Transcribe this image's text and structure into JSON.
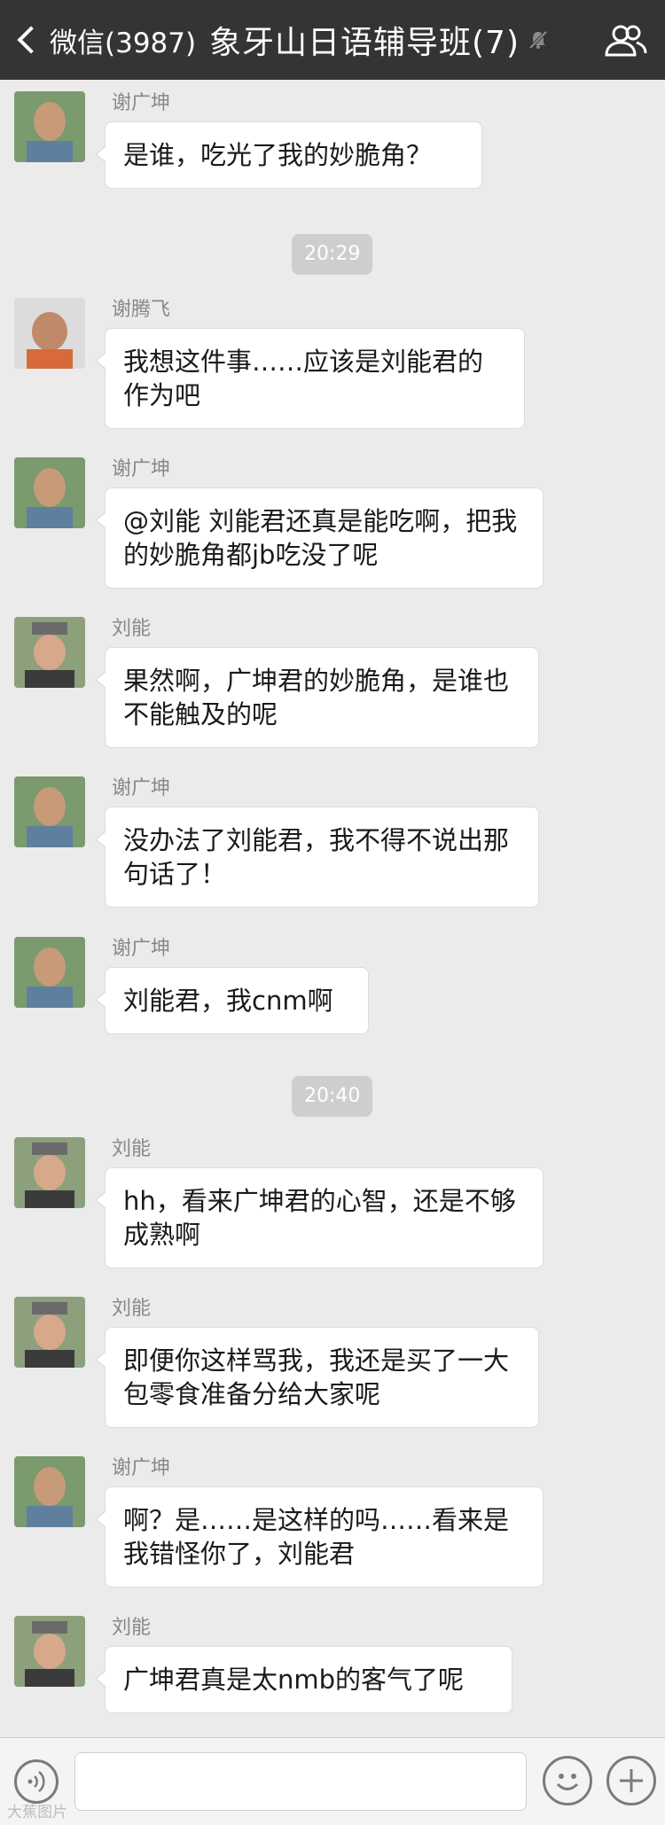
{
  "header": {
    "back_label": "微信(3987)",
    "title": "象牙山日语辅导班(7)",
    "mute_icon": "mute-bell-icon",
    "group_icon": "group-members-icon"
  },
  "messages": [
    {
      "sender": "谢广坤",
      "text": "是谁，吃光了我的妙脆角？"
    },
    {
      "sender": "谢腾飞",
      "text": "我想这件事……应该是刘能君的作为吧"
    },
    {
      "sender": "谢广坤",
      "text": "@刘能 刘能君还真是能吃啊，把我的妙脆角都jb吃没了呢"
    },
    {
      "sender": "刘能",
      "text": "果然啊，广坤君的妙脆角，是谁也不能触及的呢"
    },
    {
      "sender": "谢广坤",
      "text": "没办法了刘能君，我不得不说出那句话了！"
    },
    {
      "sender": "谢广坤",
      "text": "刘能君，我cnm啊"
    },
    {
      "sender": "刘能",
      "text": "hh，看来广坤君的心智，还是不够成熟啊"
    },
    {
      "sender": "刘能",
      "text": "即便你这样骂我，我还是买了一大包零食准备分给大家呢"
    },
    {
      "sender": "谢广坤",
      "text": "啊？是……是这样的吗……看来是我错怪你了，刘能君"
    },
    {
      "sender": "刘能",
      "text": "广坤君真是太nmb的客气了呢"
    }
  ],
  "timestamps": [
    "20:29",
    "20:40"
  ],
  "bottom_bar": {
    "voice_icon": "voice-input-icon",
    "emoji_icon": "emoji-icon",
    "plus_icon": "plus-icon"
  },
  "watermark": "大蕉图片"
}
